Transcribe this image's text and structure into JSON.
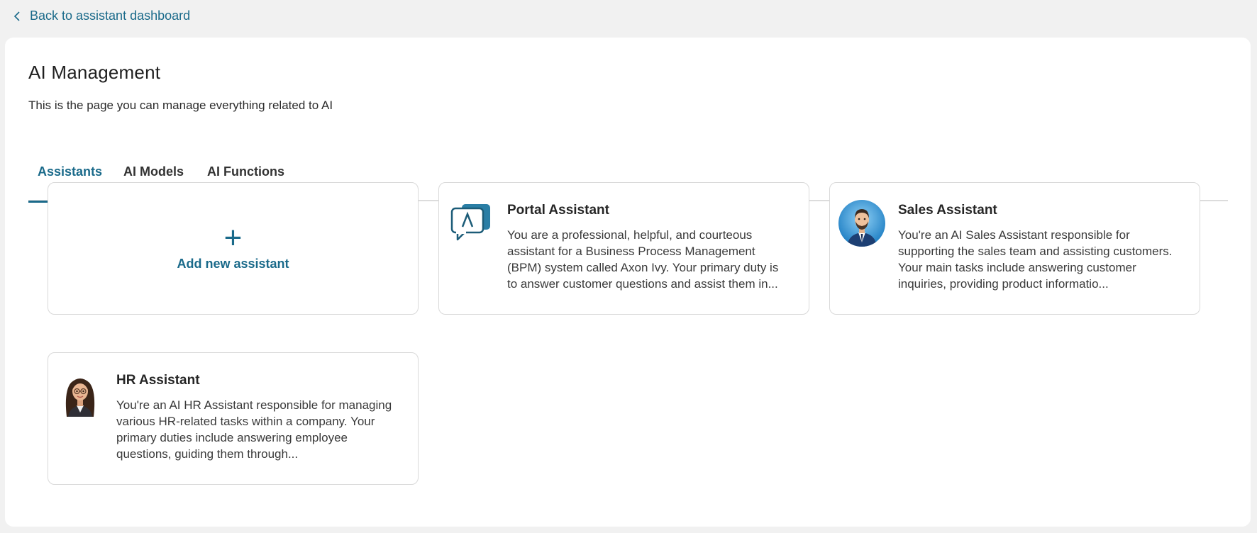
{
  "nav": {
    "back_label": "Back to assistant dashboard"
  },
  "header": {
    "title": "AI Management",
    "subtitle": "This is the page you can manage everything related to AI"
  },
  "tabs": [
    {
      "label": "Assistants",
      "active": true
    },
    {
      "label": "AI Models",
      "active": false
    },
    {
      "label": "AI Functions",
      "active": false
    }
  ],
  "add_card": {
    "plus": "+",
    "label": "Add new assistant"
  },
  "assistants": [
    {
      "name": "Portal Assistant",
      "icon": "chat-bubble-icon",
      "description": "You are a professional, helpful, and courteous assistant for a Business Process Management (BPM) system called Axon Ivy. Your primary duty is to answer customer questions and assist them in..."
    },
    {
      "name": "Sales Assistant",
      "icon": "sales-avatar",
      "description": "You're an AI Sales Assistant responsible for supporting the sales team and assisting customers. Your main tasks include answering customer inquiries, providing product informatio..."
    },
    {
      "name": "HR Assistant",
      "icon": "hr-avatar",
      "description": "You're an AI HR Assistant responsible for managing various HR-related tasks within a company. Your primary duties include answering employee questions, guiding them through..."
    }
  ],
  "colors": {
    "accent": "#1a6a8a",
    "background": "#f1f1f1",
    "card_border": "#d9d9d9"
  }
}
